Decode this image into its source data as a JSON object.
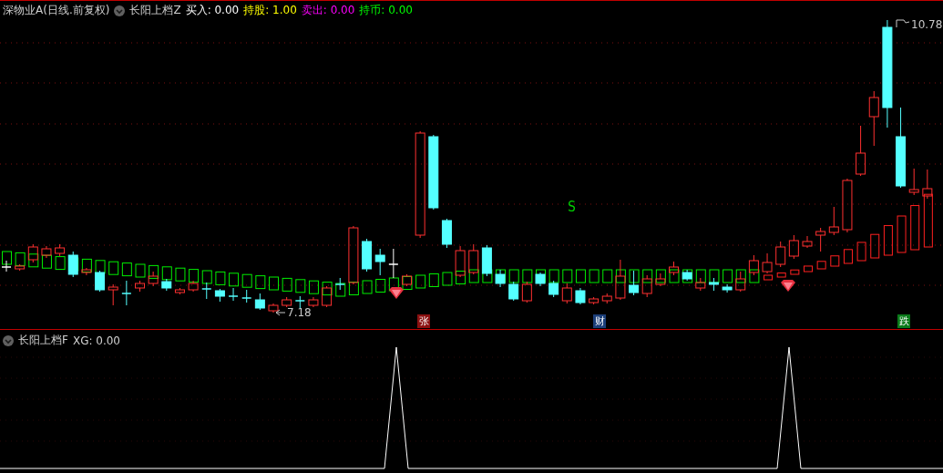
{
  "main_panel": {
    "title": "深物业A(日线.前复权)",
    "expanded": true,
    "indicator": "长阳上档Z",
    "readings": [
      {
        "text": "买入: 0.00",
        "color": "#ffffff"
      },
      {
        "text": "持股: 1.00",
        "color": "#ffff00"
      },
      {
        "text": "卖出: 0.00",
        "color": "#ff00ff"
      },
      {
        "text": "持币: 0.00",
        "color": "#00ff00"
      }
    ],
    "price_labels": [
      {
        "kind": "high",
        "text": "10.78"
      },
      {
        "kind": "low",
        "text": "7.18"
      }
    ],
    "signal_label": "S",
    "badges": [
      {
        "text": "张",
        "color": "#8b1010"
      },
      {
        "text": "财",
        "color": "#1c3f7a"
      },
      {
        "text": "跌",
        "color": "#0a7a1a"
      }
    ]
  },
  "sub_panel": {
    "indicator": "长阳上档F",
    "expanded": true,
    "readings": [
      {
        "text": "XG: 0.00"
      }
    ]
  }
}
